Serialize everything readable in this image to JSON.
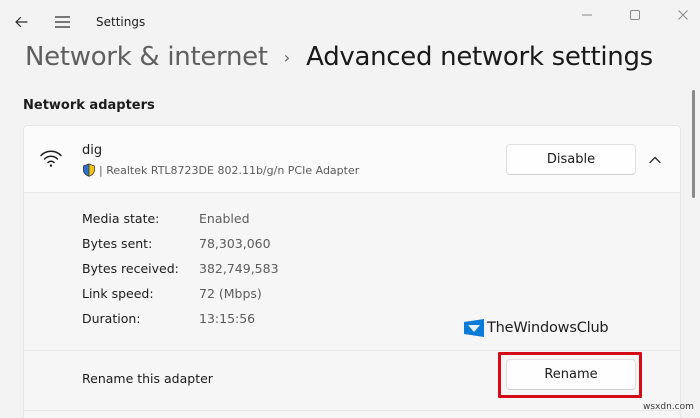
{
  "app": {
    "title": "Settings"
  },
  "breadcrumb": {
    "parent": "Network & internet",
    "separator": "›",
    "current": "Advanced network settings"
  },
  "section": {
    "title": "Network adapters"
  },
  "adapter": {
    "name": "dig",
    "description": "| Realtek RTL8723DE 802.11b/g/n PCIe Adapter",
    "disable_label": "Disable",
    "expanded": true,
    "properties": [
      {
        "label": "Media state:",
        "value": "Enabled"
      },
      {
        "label": "Bytes sent:",
        "value": "78,303,060"
      },
      {
        "label": "Bytes received:",
        "value": "382,749,583"
      },
      {
        "label": "Link speed:",
        "value": "72 (Mbps)"
      },
      {
        "label": "Duration:",
        "value": "13:15:56"
      }
    ],
    "rename": {
      "label": "Rename this adapter",
      "button": "Rename"
    }
  },
  "watermark": {
    "text": "TheWindowsClub"
  },
  "site_mark": "wsxdn.com",
  "colors": {
    "highlight": "#d40b19",
    "logo": "#0a7bd8"
  },
  "icons": [
    "back-arrow-icon",
    "hamburger-menu-icon",
    "minimize-icon",
    "maximize-icon",
    "close-icon",
    "wifi-icon",
    "shield-icon",
    "chevron-up-icon"
  ]
}
